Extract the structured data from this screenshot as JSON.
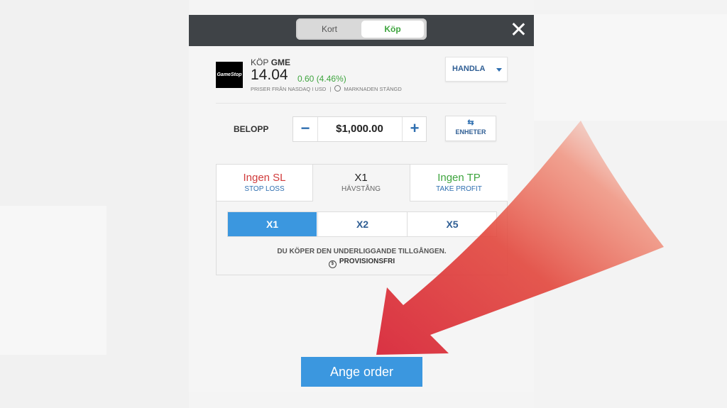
{
  "toggle": {
    "sell_label": "Kort",
    "buy_label": "Köp"
  },
  "instrument": {
    "logo_text": "GameStop",
    "action": "KÖP",
    "ticker": "GME",
    "price": "14.04",
    "change": "0.60 (4.46%)",
    "source": "PRISER FRÅN NASDAQ I USD",
    "market_status": "MARKNADEN STÄNGD"
  },
  "trade_dropdown": {
    "label": "HANDLA"
  },
  "amount": {
    "label": "BELOPP",
    "minus": "−",
    "value": "$1,000.00",
    "plus": "+",
    "units_symbol": "⇆",
    "units_label": "ENHETER"
  },
  "tabs": [
    {
      "big": "Ingen SL",
      "small": "STOP LOSS"
    },
    {
      "big": "X1",
      "small": "HÄVSTÅNG"
    },
    {
      "big": "Ingen TP",
      "small": "TAKE PROFIT"
    }
  ],
  "leverage_options": [
    "X1",
    "X2",
    "X5"
  ],
  "leverage_selected": "X1",
  "note": "DU KÖPER DEN UNDERLIGGANDE TILLGÅNGEN.",
  "commission": "PROVISIONSFRI",
  "order_button": "Ange order",
  "colors": {
    "accent_blue": "#3b97df",
    "buy_green": "#3fa53f",
    "sl_red": "#d13b3b",
    "topbar": "#3f4347",
    "arrow": "#e03a3a"
  }
}
